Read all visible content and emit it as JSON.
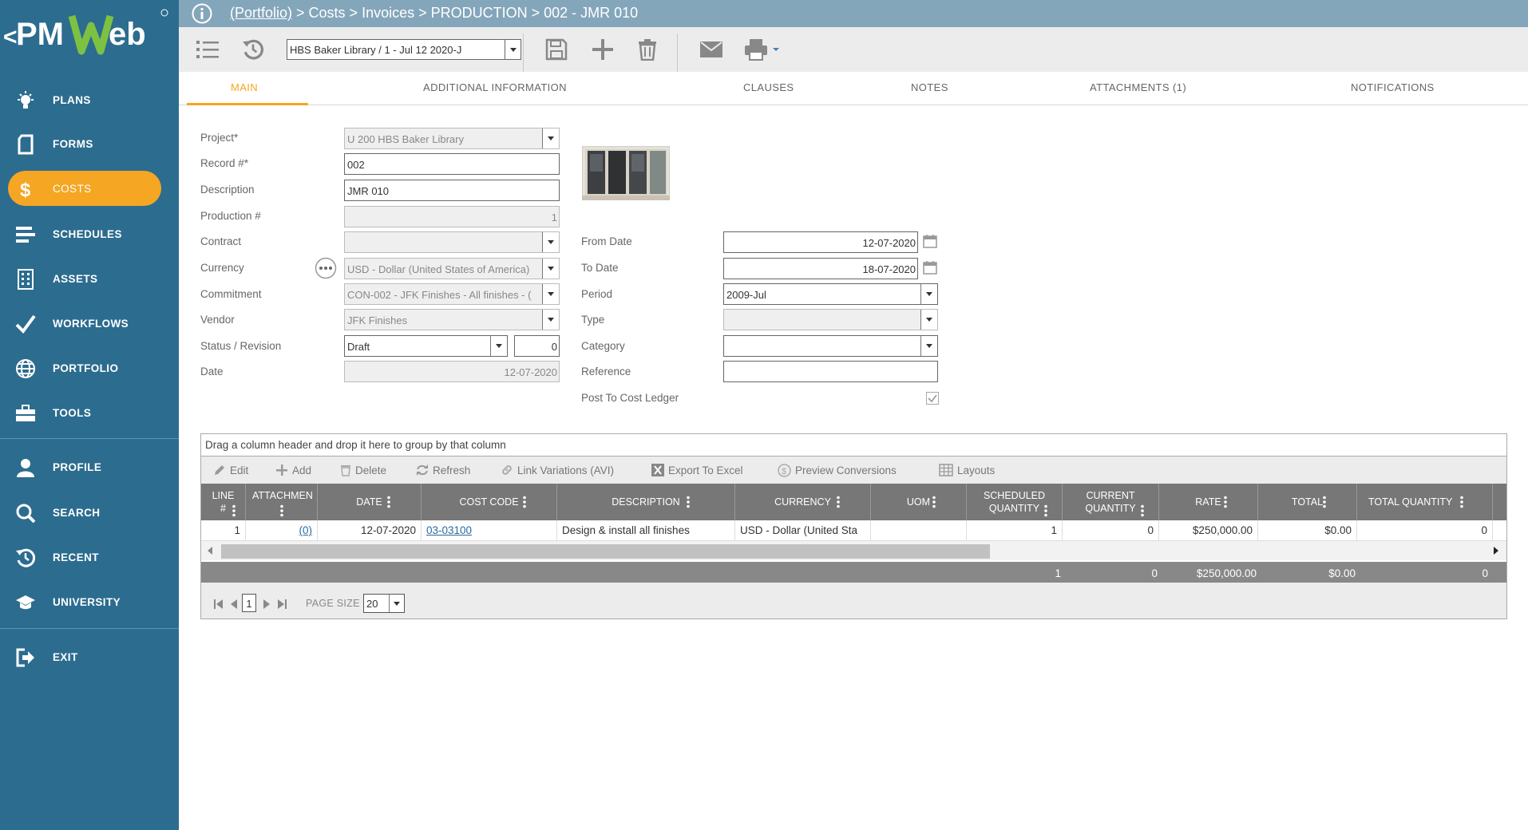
{
  "app": {
    "logo_text": "PMWeb"
  },
  "sidebar": {
    "items": [
      {
        "label": "PLANS",
        "icon": "bulb-icon"
      },
      {
        "label": "FORMS",
        "icon": "form-icon"
      },
      {
        "label": "COSTS",
        "icon": "dollar-icon",
        "active": true
      },
      {
        "label": "SCHEDULES",
        "icon": "schedule-icon"
      },
      {
        "label": "ASSETS",
        "icon": "building-icon"
      },
      {
        "label": "WORKFLOWS",
        "icon": "check-icon"
      },
      {
        "label": "PORTFOLIO",
        "icon": "globe-icon"
      },
      {
        "label": "TOOLS",
        "icon": "toolbox-icon"
      },
      {
        "label": "PROFILE",
        "icon": "user-icon"
      },
      {
        "label": "SEARCH",
        "icon": "search-icon"
      },
      {
        "label": "RECENT",
        "icon": "history-icon"
      },
      {
        "label": "UNIVERSITY",
        "icon": "graduation-cap-icon"
      },
      {
        "label": "EXIT",
        "icon": "exit-icon"
      }
    ]
  },
  "breadcrumb": {
    "portfolio": "(Portfolio)",
    "rest": " > Costs > Invoices > PRODUCTION > 002 - JMR 010"
  },
  "toolbar": {
    "record_selector": "HBS Baker Library / 1 - Jul 12 2020-J"
  },
  "tabs": [
    {
      "label": "MAIN",
      "active": true
    },
    {
      "label": "ADDITIONAL INFORMATION"
    },
    {
      "label": "CLAUSES"
    },
    {
      "label": "NOTES"
    },
    {
      "label": "ATTACHMENTS (1)"
    },
    {
      "label": "NOTIFICATIONS"
    }
  ],
  "form": {
    "project": {
      "label": "Project*",
      "value": "U 200    HBS Baker Library"
    },
    "record": {
      "label": "Record #*",
      "value": "002"
    },
    "description": {
      "label": "Description",
      "value": "JMR 010"
    },
    "production": {
      "label": "Production #",
      "value": "1"
    },
    "contract": {
      "label": "Contract",
      "value": ""
    },
    "currency": {
      "label": "Currency",
      "value": "USD - Dollar (United States of America)"
    },
    "commitment": {
      "label": "Commitment",
      "value": "CON-002 - JFK Finishes - All finishes - ( "
    },
    "vendor": {
      "label": "Vendor",
      "value": "JFK Finishes"
    },
    "status": {
      "label": "Status / Revision",
      "value": "Draft",
      "revision": "0"
    },
    "date": {
      "label": "Date",
      "value": "12-07-2020"
    },
    "from_date": {
      "label": "From Date",
      "value": "12-07-2020"
    },
    "to_date": {
      "label": "To Date",
      "value": "18-07-2020"
    },
    "period": {
      "label": "Period",
      "value": "2009-Jul"
    },
    "type": {
      "label": "Type",
      "value": ""
    },
    "category": {
      "label": "Category",
      "value": ""
    },
    "reference": {
      "label": "Reference",
      "value": ""
    },
    "post_ledger": {
      "label": "Post To Cost Ledger",
      "checked": true
    }
  },
  "grid": {
    "group_hint": "Drag a column header and drop it here to group by that column",
    "toolbar": {
      "edit": "Edit",
      "add": "Add",
      "delete": "Delete",
      "refresh": "Refresh",
      "link_variations": "Link Variations (AVI)",
      "export": "Export To Excel",
      "preview": "Preview Conversions",
      "layouts": "Layouts"
    },
    "columns": {
      "line": "LINE\n#",
      "attachments": "ATTACHMEN",
      "date": "DATE",
      "cost_code": "COST CODE",
      "description": "DESCRIPTION",
      "currency": "CURRENCY",
      "uom": "UOM",
      "scheduled_qty": "SCHEDULED\nQUANTITY",
      "current_qty": "CURRENT\nQUANTITY",
      "rate": "RATE",
      "total": "TOTAL",
      "total_qty": "TOTAL QUANTITY"
    },
    "rows": [
      {
        "line": "1",
        "attachments": "(0)",
        "date": "12-07-2020",
        "cost_code": "03-03100",
        "description": "Design & install all finishes",
        "currency": "USD - Dollar (United Sta",
        "uom": "",
        "scheduled_qty": "1",
        "current_qty": "0",
        "rate": "$250,000.00",
        "total": "$0.00",
        "total_qty": "0"
      }
    ],
    "totals": {
      "scheduled_qty": "1",
      "current_qty": "0",
      "rate": "$250,000.00",
      "total": "$0.00",
      "total_qty": "0"
    },
    "pager": {
      "page": "1",
      "page_size_label": "PAGE SIZE",
      "page_size": "20"
    }
  },
  "colors": {
    "sidebar": "#2c6c8f",
    "accent": "#f5a623",
    "titlebar": "#84a6bb",
    "grid_header": "#777777"
  }
}
